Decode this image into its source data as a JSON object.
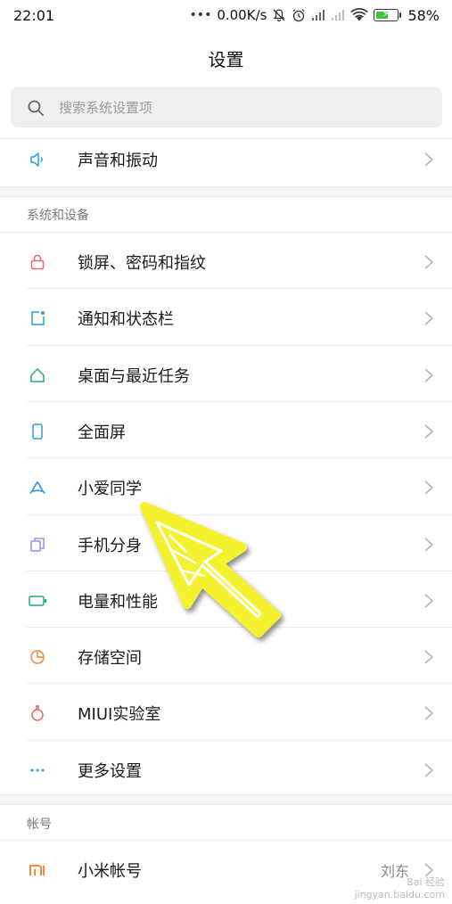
{
  "status_bar": {
    "time": "22:01",
    "network_speed": "0.00K/s",
    "battery_percent": "58%",
    "icons": [
      "dots-icon",
      "mute-icon",
      "alarm-icon",
      "signal-icon",
      "signal-icon",
      "wifi-icon",
      "battery-icon"
    ],
    "battery_level": 0.58
  },
  "header": {
    "title": "设置"
  },
  "search": {
    "placeholder": "搜索系统设置项"
  },
  "top_item": {
    "label": "声音和振动",
    "icon": "speaker-icon"
  },
  "system_section": {
    "header": "系统和设备",
    "items": [
      {
        "label": "锁屏、密码和指纹",
        "icon": "lock-icon",
        "color": "#e36a6a"
      },
      {
        "label": "通知和状态栏",
        "icon": "notification-icon",
        "color": "#2a9fd6"
      },
      {
        "label": "桌面与最近任务",
        "icon": "home-icon",
        "color": "#2aa876"
      },
      {
        "label": "全面屏",
        "icon": "phone-icon",
        "color": "#2a9fd6"
      },
      {
        "label": "小爱同学",
        "icon": "xiaoai-icon",
        "color": "#3b8fe0"
      },
      {
        "label": "手机分身",
        "icon": "dual-icon",
        "color": "#a08be0"
      },
      {
        "label": "电量和性能",
        "icon": "battery-icon",
        "color": "#2aa876"
      },
      {
        "label": "存储空间",
        "icon": "storage-pie-icon",
        "color": "#f08a3c"
      },
      {
        "label": "MIUI实验室",
        "icon": "flask-icon",
        "color": "#e36a6a"
      },
      {
        "label": "更多设置",
        "icon": "more-icon",
        "color": "#2a9fd6"
      }
    ]
  },
  "account_section": {
    "header": "帐号",
    "items": [
      {
        "label": "小米帐号",
        "icon": "mi-icon",
        "color": "#f08a3c",
        "value": "刘东"
      }
    ]
  },
  "watermark": {
    "line1": "Bai 经验",
    "line2": "jingyan.baidu.com"
  },
  "colors": {
    "accent_arrow": "#f4f22e",
    "background": "#ffffff",
    "section_gap": "#f5f5f5"
  }
}
